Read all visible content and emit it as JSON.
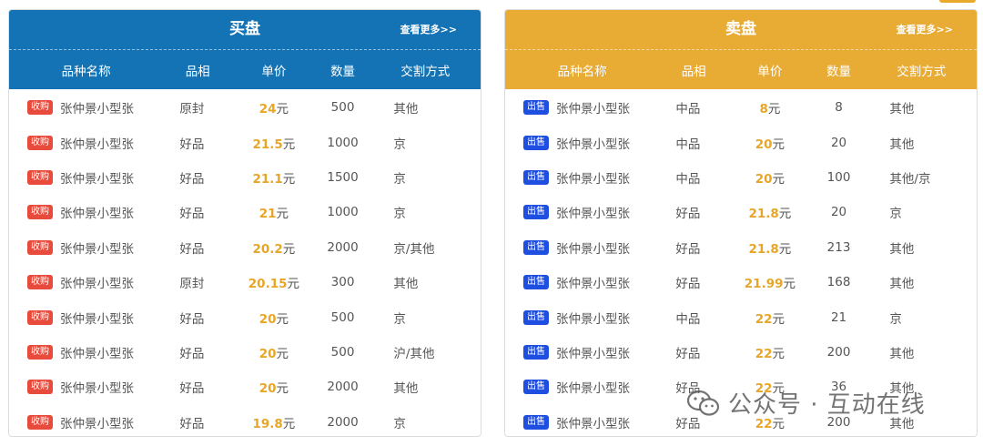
{
  "colors": {
    "buy_header": "#1473b4",
    "sell_header": "#e8ac34",
    "price": "#e8a628",
    "buy_badge": "#e84b3c",
    "sell_badge": "#1f4fe0"
  },
  "buy": {
    "title": "买盘",
    "more_label": "查看更多>>",
    "columns": [
      "品种名称",
      "品相",
      "单价",
      "数量",
      "交割方式"
    ],
    "rows": [
      {
        "tag": "收购",
        "name": "张仲景小型张",
        "grade": "原封",
        "price": "24",
        "unit": "元",
        "qty": "500",
        "method": "其他"
      },
      {
        "tag": "收购",
        "name": "张仲景小型张",
        "grade": "好品",
        "price": "21.5",
        "unit": "元",
        "qty": "1000",
        "method": "京"
      },
      {
        "tag": "收购",
        "name": "张仲景小型张",
        "grade": "好品",
        "price": "21.1",
        "unit": "元",
        "qty": "1500",
        "method": "京"
      },
      {
        "tag": "收购",
        "name": "张仲景小型张",
        "grade": "好品",
        "price": "21",
        "unit": "元",
        "qty": "1000",
        "method": "京"
      },
      {
        "tag": "收购",
        "name": "张仲景小型张",
        "grade": "好品",
        "price": "20.2",
        "unit": "元",
        "qty": "2000",
        "method": "京/其他"
      },
      {
        "tag": "收购",
        "name": "张仲景小型张",
        "grade": "原封",
        "price": "20.15",
        "unit": "元",
        "qty": "300",
        "method": "其他"
      },
      {
        "tag": "收购",
        "name": "张仲景小型张",
        "grade": "好品",
        "price": "20",
        "unit": "元",
        "qty": "500",
        "method": "京"
      },
      {
        "tag": "收购",
        "name": "张仲景小型张",
        "grade": "好品",
        "price": "20",
        "unit": "元",
        "qty": "500",
        "method": "沪/其他"
      },
      {
        "tag": "收购",
        "name": "张仲景小型张",
        "grade": "好品",
        "price": "20",
        "unit": "元",
        "qty": "2000",
        "method": "其他"
      },
      {
        "tag": "收购",
        "name": "张仲景小型张",
        "grade": "好品",
        "price": "19.8",
        "unit": "元",
        "qty": "2000",
        "method": "京"
      }
    ]
  },
  "sell": {
    "title": "卖盘",
    "more_label": "查看更多>>",
    "columns": [
      "品种名称",
      "品相",
      "单价",
      "数量",
      "交割方式"
    ],
    "rows": [
      {
        "tag": "出售",
        "name": "张仲景小型张",
        "grade": "中品",
        "price": "8",
        "unit": "元",
        "qty": "8",
        "method": "其他"
      },
      {
        "tag": "出售",
        "name": "张仲景小型张",
        "grade": "中品",
        "price": "20",
        "unit": "元",
        "qty": "20",
        "method": "其他"
      },
      {
        "tag": "出售",
        "name": "张仲景小型张",
        "grade": "中品",
        "price": "20",
        "unit": "元",
        "qty": "100",
        "method": "其他/京"
      },
      {
        "tag": "出售",
        "name": "张仲景小型张",
        "grade": "好品",
        "price": "21.8",
        "unit": "元",
        "qty": "20",
        "method": "京"
      },
      {
        "tag": "出售",
        "name": "张仲景小型张",
        "grade": "好品",
        "price": "21.8",
        "unit": "元",
        "qty": "213",
        "method": "其他"
      },
      {
        "tag": "出售",
        "name": "张仲景小型张",
        "grade": "好品",
        "price": "21.99",
        "unit": "元",
        "qty": "168",
        "method": "其他"
      },
      {
        "tag": "出售",
        "name": "张仲景小型张",
        "grade": "中品",
        "price": "22",
        "unit": "元",
        "qty": "21",
        "method": "京"
      },
      {
        "tag": "出售",
        "name": "张仲景小型张",
        "grade": "好品",
        "price": "22",
        "unit": "元",
        "qty": "200",
        "method": "其他"
      },
      {
        "tag": "出售",
        "name": "张仲景小型张",
        "grade": "好品",
        "price": "22",
        "unit": "元",
        "qty": "36",
        "method": "其他"
      },
      {
        "tag": "出售",
        "name": "张仲景小型张",
        "grade": "好品",
        "price": "22",
        "unit": "元",
        "qty": "200",
        "method": "其他"
      }
    ]
  },
  "watermark": {
    "text": "公众号 · 互动在线",
    "icon": "wechat-icon"
  }
}
